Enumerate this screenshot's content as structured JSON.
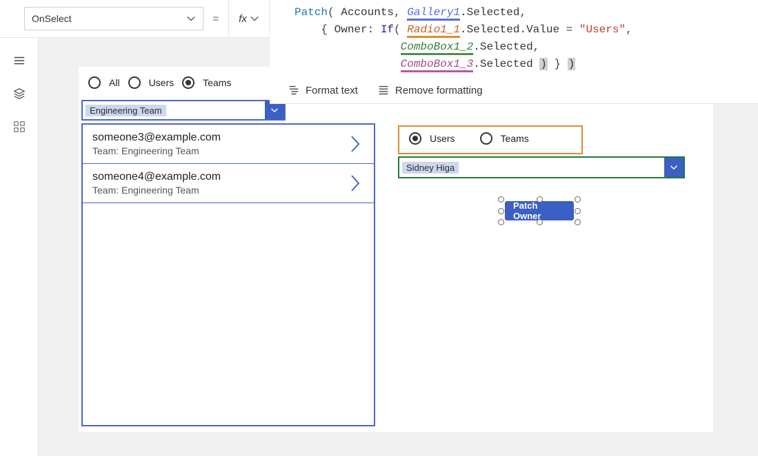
{
  "topbar": {
    "property": "OnSelect",
    "equals": "=",
    "fx": "fx"
  },
  "formula": {
    "text_plain": "Patch( Accounts, Gallery1.Selected,\n    { Owner: If( Radio1_1.Selected.Value = \"Users\",\n                ComboBox1_2.Selected,\n                ComboBox1_3.Selected ) } )",
    "tokens": {
      "patch": "Patch",
      "open": "( ",
      "accounts": "Accounts",
      "comma1": ", ",
      "gallery": "Gallery1",
      "dot_sel": ".Selected",
      "comma2": ",",
      "brace_open": "    { ",
      "owner": "Owner: ",
      "if": "If",
      "open2": "( ",
      "radio": "Radio1_1",
      "dot_sel_val": ".Selected.Value ",
      "eq": "= ",
      "users": "\"Users\"",
      "comma3": ",",
      "indent3a": "                ",
      "cb2": "ComboBox1_2",
      "dot_sel2": ".Selected",
      "comma4": ",",
      "indent3b": "                ",
      "cb3": "ComboBox1_3",
      "dot_sel3": ".Selected ",
      "close_inner": ")",
      "brace_close": " } ",
      "close_outer": ")"
    },
    "format_text": "Format text",
    "remove_formatting": "Remove formatting"
  },
  "left_radio": {
    "options": [
      "All",
      "Users",
      "Teams"
    ],
    "selected": "Teams"
  },
  "left_combo": {
    "value": "Engineering Team"
  },
  "gallery_items": [
    {
      "email": "someone3@example.com",
      "team_line": "Team: Engineering Team"
    },
    {
      "email": "someone4@example.com",
      "team_line": "Team: Engineering Team"
    }
  ],
  "right_radio": {
    "options": [
      "Users",
      "Teams"
    ],
    "selected": "Users"
  },
  "right_combo": {
    "value": "Sidney Higa"
  },
  "button": {
    "label": "Patch Owner"
  }
}
